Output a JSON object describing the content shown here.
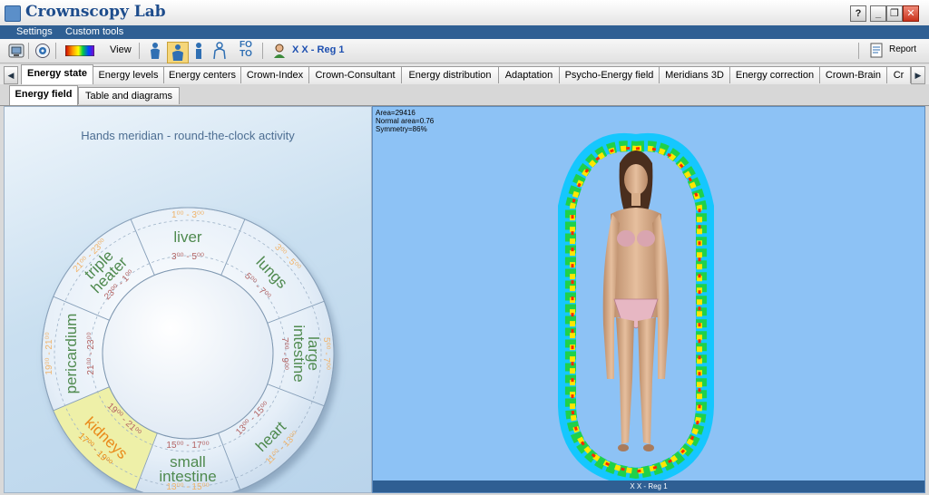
{
  "app": {
    "title": "Crownscopy Lab"
  },
  "window_controls": {
    "help": "?",
    "minimize": "_",
    "restore": "❐",
    "close": "✕"
  },
  "menu": {
    "items": [
      "Settings",
      "Custom tools"
    ]
  },
  "toolbar": {
    "view_label": "View",
    "foto_label": "FO\nTO",
    "patient_label": "X X  - Reg 1",
    "report_label": "Report",
    "icons": [
      "camera-icon",
      "clock-icon",
      "palette-icon",
      "person-icon",
      "person-active-icon",
      "person-side-icon",
      "person-outline-icon",
      "foto-icon",
      "patient-icon",
      "report-icon"
    ]
  },
  "tabs": {
    "items": [
      "Energy state",
      "Energy levels",
      "Energy centers",
      "Crown-Index",
      "Crown-Consultant",
      "Energy distribution",
      "Adaptation",
      "Psycho-Energy field",
      "Meridians 3D",
      "Energy correction",
      "Crown-Brain",
      "Cr"
    ],
    "active": "Energy state",
    "left_arrow": "◀",
    "right_arrow": "▶"
  },
  "subtabs": {
    "items": [
      "Energy field",
      "Table and diagrams"
    ],
    "active": "Energy field"
  },
  "clock_chart": {
    "title": "Hands meridian - round-the-clock activity",
    "highlight_color": "#eef0a8",
    "segments": [
      {
        "name": "liver",
        "lines": [
          "liver"
        ],
        "outer_time": "1⁰⁰ - 3⁰⁰",
        "inner_time": "3⁰⁰ - 5⁰⁰",
        "highlight": false
      },
      {
        "name": "lungs",
        "lines": [
          "lungs"
        ],
        "outer_time": "3⁰⁰ - 5⁰⁰",
        "inner_time": "5⁰⁰ - 7⁰⁰",
        "highlight": false
      },
      {
        "name": "large intestine",
        "lines": [
          "large",
          "intestine"
        ],
        "outer_time": "5⁰⁰ - 7⁰⁰",
        "inner_time": "7⁰⁰ - 9⁰⁰",
        "highlight": false
      },
      {
        "name": "heart",
        "lines": [
          "heart"
        ],
        "outer_time": "11⁰⁰ - 13⁰⁰",
        "inner_time": "13⁰⁰ - 15⁰⁰",
        "highlight": false
      },
      {
        "name": "small intestine",
        "lines": [
          "small",
          "intestine"
        ],
        "outer_time": "13⁰⁰ - 15⁰⁰",
        "inner_time": "15⁰⁰ - 17⁰⁰",
        "highlight": false
      },
      {
        "name": "kidneys",
        "lines": [
          "kidneys"
        ],
        "outer_time": "17⁰⁰ - 19⁰⁰",
        "inner_time": "19⁰⁰ - 21⁰⁰",
        "highlight": true
      },
      {
        "name": "pericardium",
        "lines": [
          "pericardium"
        ],
        "outer_time": "19⁰⁰ - 21⁰⁰",
        "inner_time": "21⁰⁰ - 23⁰⁰",
        "highlight": false
      },
      {
        "name": "triple heater",
        "lines": [
          "triple",
          "heater"
        ],
        "outer_time": "21⁰⁰ - 23⁰⁰",
        "inner_time": "23⁰⁰ - 1⁰⁰",
        "highlight": false
      }
    ]
  },
  "energy_field": {
    "area_label": "Area=29416",
    "normal_area_label": "Normal area=0.76",
    "symmetry_label": "Symmetry=86%",
    "status": "X X  - Reg 1"
  }
}
